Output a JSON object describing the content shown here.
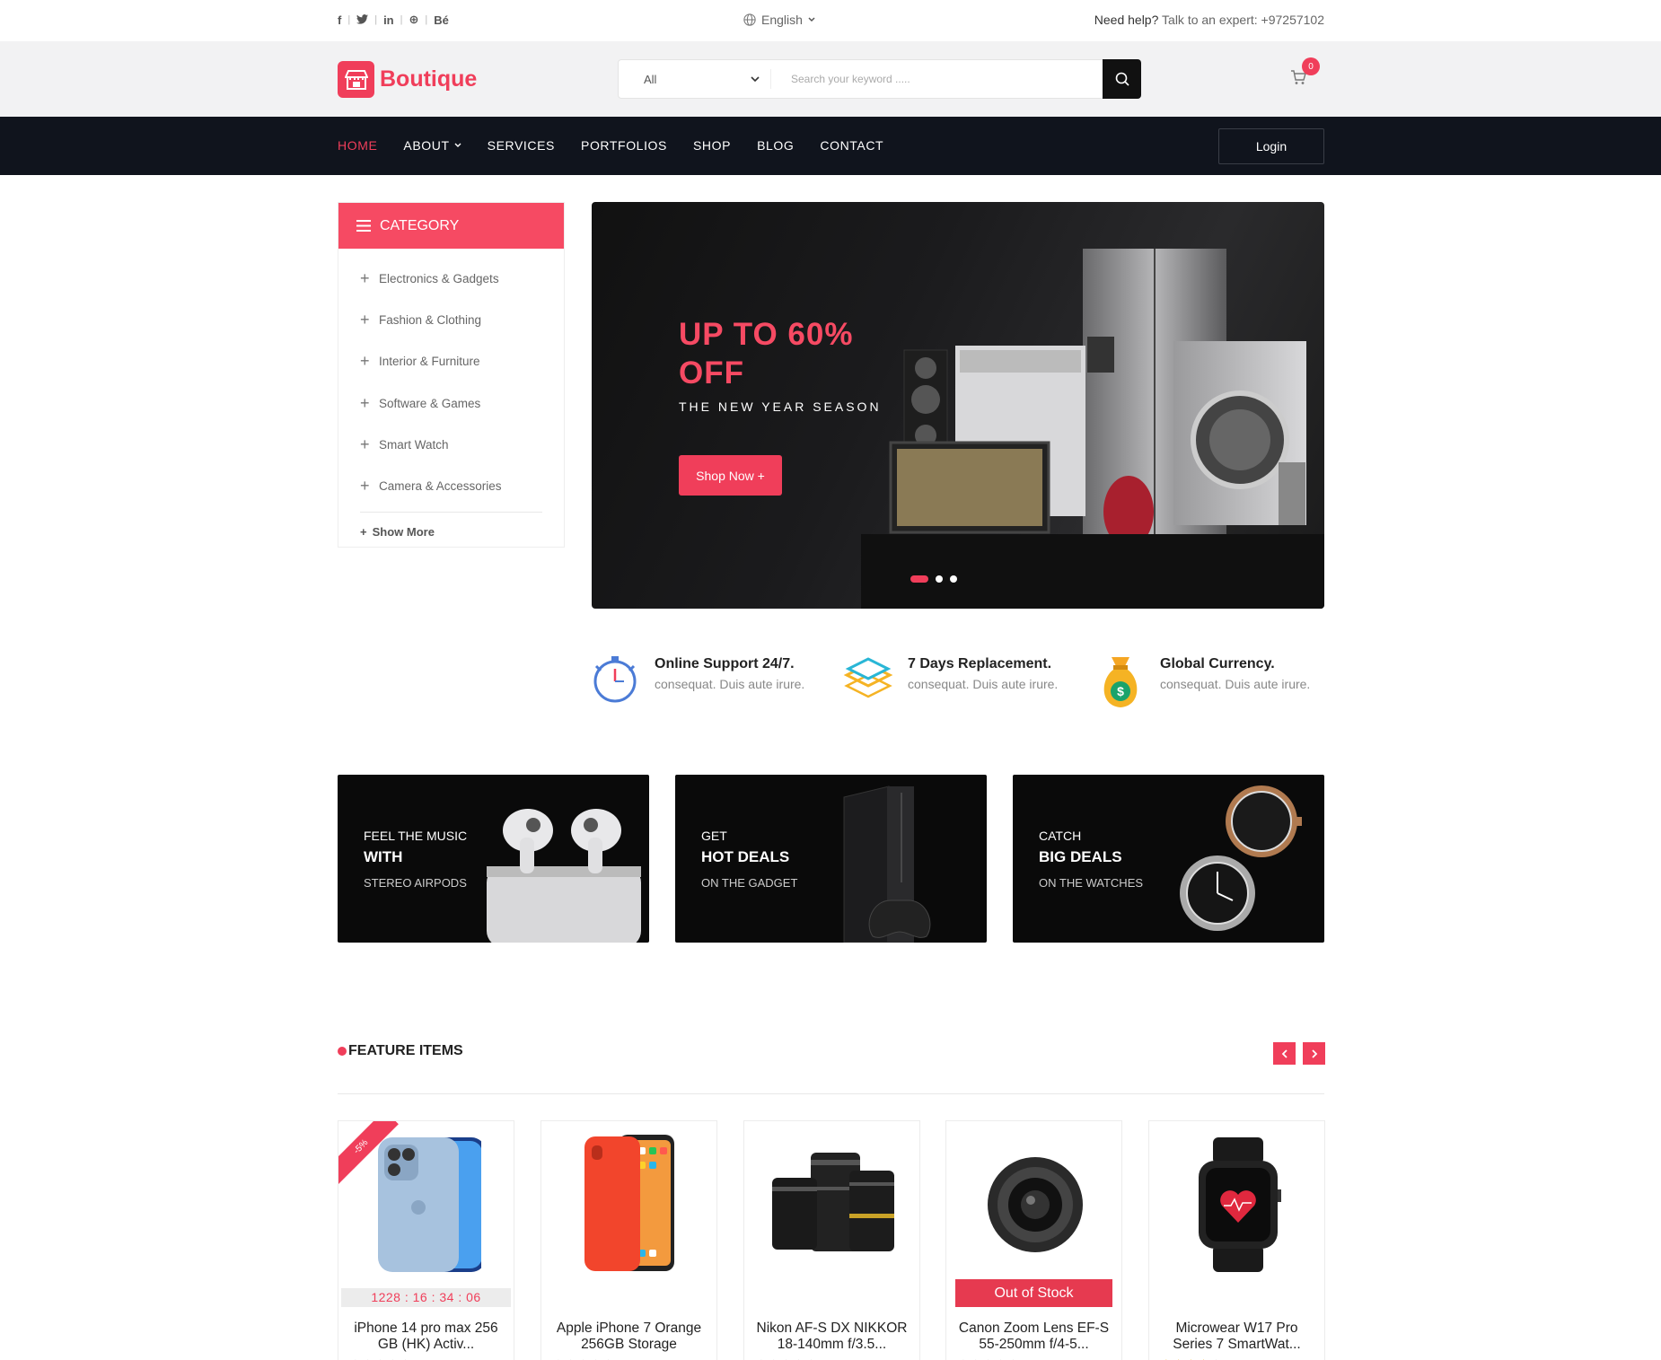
{
  "topbar": {
    "social": [
      "f",
      "t",
      "in",
      "⊕",
      "Bé"
    ],
    "language": "English",
    "help_label": "Need help?",
    "help_text": "Talk to an expert: +97257102"
  },
  "header": {
    "brand": "Boutique",
    "search_category": "All",
    "search_placeholder": "Search your keyword .....",
    "cart_count": "0"
  },
  "nav": {
    "items": [
      "HOME",
      "ABOUT",
      "SERVICES",
      "PORTFOLIOS",
      "SHOP",
      "BLOG",
      "CONTACT"
    ],
    "login": "Login"
  },
  "category": {
    "title": "CATEGORY",
    "items": [
      "Electronics & Gadgets",
      "Fashion & Clothing",
      "Interior & Furniture",
      "Software & Games",
      "Smart Watch",
      "Camera & Accessories"
    ],
    "show_more": "Show More"
  },
  "hero": {
    "title_line1": "UP TO 60%",
    "title_line2": "OFF",
    "subtitle": "THE NEW YEAR SEASON",
    "button": "Shop Now +"
  },
  "features": [
    {
      "title": "Online Support 24/7.",
      "sub": "consequat. Duis aute irure.",
      "icon": "stopwatch-icon"
    },
    {
      "title": "7 Days Replacement.",
      "sub": "consequat. Duis aute irure.",
      "icon": "layers-icon"
    },
    {
      "title": "Global Currency.",
      "sub": "consequat. Duis aute irure.",
      "icon": "money-bag-icon"
    }
  ],
  "promos": [
    {
      "l1": "FEEL THE MUSIC",
      "l2": "WITH",
      "l3": "STEREO AIRPODS"
    },
    {
      "l1": "GET",
      "l2": "HOT DEALS",
      "l3": "ON THE GADGET"
    },
    {
      "l1": "CATCH",
      "l2": "BIG DEALS",
      "l3": "ON THE WATCHES"
    }
  ],
  "feature_items": {
    "title": "FEATURE ITEMS",
    "products": [
      {
        "name": "iPhone 14 pro max 256 GB (HK) Activ...",
        "timer": "1228 : 16 : 34 : 06",
        "badge": "-5%"
      },
      {
        "name": "Apple iPhone 7 Orange 256GB Storage"
      },
      {
        "name": "Nikon AF-S DX NIKKOR 18-140mm f/3.5..."
      },
      {
        "name": "Canon Zoom Lens EF-S 55-250mm f/4-5...",
        "status": "Out of Stock"
      },
      {
        "name": "Microwear W17 Pro Series 7 SmartWat..."
      }
    ]
  },
  "colors": {
    "accent": "#f03e5a",
    "nav_bg": "#10141d"
  }
}
